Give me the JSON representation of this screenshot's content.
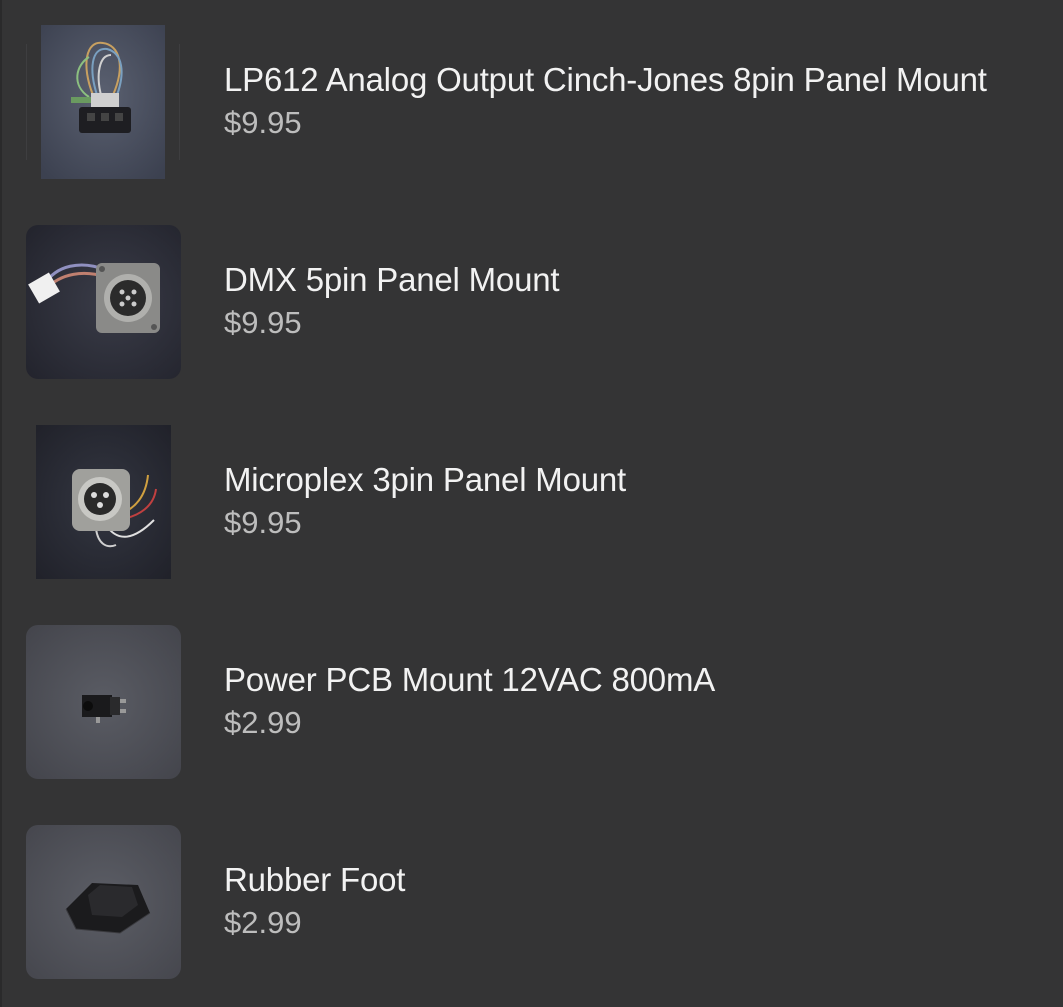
{
  "products": [
    {
      "name": "LP612 Analog Output Cinch-Jones 8pin Panel Mount",
      "price": "$9.95",
      "image_icon": "cinch-jones-connector-photo"
    },
    {
      "name": "DMX 5pin Panel Mount",
      "price": "$9.95",
      "image_icon": "xlr-5pin-connector-photo"
    },
    {
      "name": "Microplex 3pin Panel Mount",
      "price": "$9.95",
      "image_icon": "xlr-3pin-connector-photo"
    },
    {
      "name": "Power PCB Mount 12VAC 800mA",
      "price": "$2.99",
      "image_icon": "power-jack-photo"
    },
    {
      "name": "Rubber Foot",
      "price": "$2.99",
      "image_icon": "rubber-foot-photo"
    }
  ],
  "colors": {
    "background": "#343435",
    "name_text": "#f2f2f2",
    "price_text": "#bdbdbd"
  }
}
